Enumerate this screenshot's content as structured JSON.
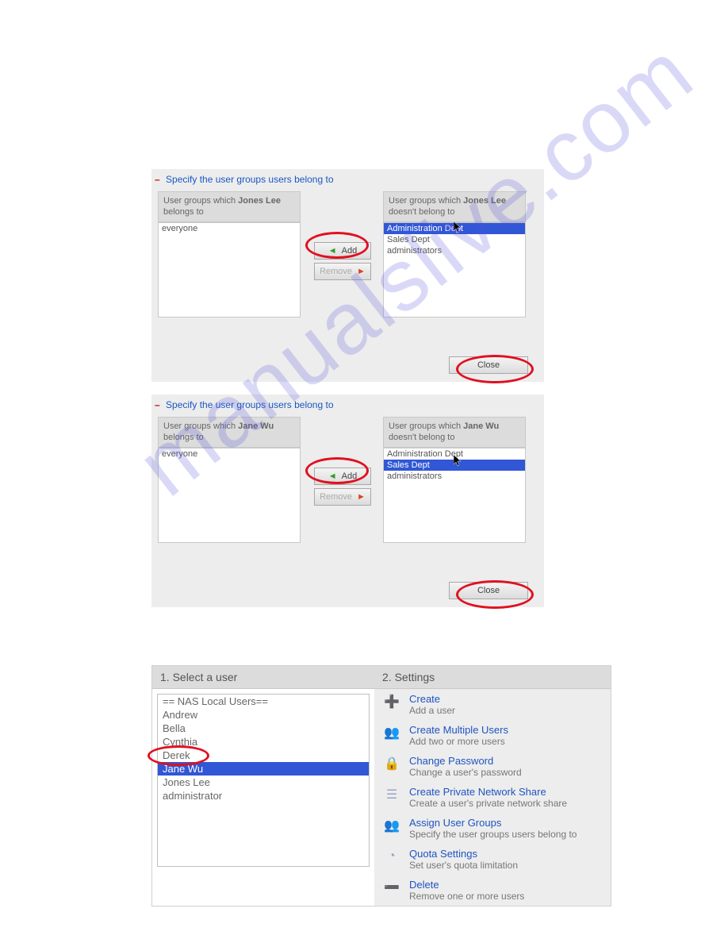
{
  "dialog1": {
    "section_title": "Specify the user groups users belong to",
    "user_name": "Jones Lee",
    "left_header_prefix": "User groups which ",
    "left_header_suffix": " belongs to",
    "right_header_prefix": "User groups which ",
    "right_header_suffix": " doesn't belong to",
    "left_items": [
      "everyone"
    ],
    "right_items": [
      "Administration Dept",
      "Sales Dept",
      "administrators"
    ],
    "right_selected_index": 0,
    "add_label": "Add",
    "remove_label": "Remove",
    "close_label": "Close"
  },
  "dialog2": {
    "section_title": "Specify the user groups users belong to",
    "user_name": "Jane Wu",
    "left_header_prefix": "User groups which ",
    "left_header_suffix": " belongs to",
    "right_header_prefix": "User groups which ",
    "right_header_suffix": " doesn't belong to",
    "left_items": [
      "everyone"
    ],
    "right_items": [
      "Administration Dept",
      "Sales Dept",
      "administrators"
    ],
    "right_selected_index": 1,
    "add_label": "Add",
    "remove_label": "Remove",
    "close_label": "Close"
  },
  "bottom": {
    "left_title": "1. Select a user",
    "right_title": "2. Settings",
    "items": [
      "== NAS Local Users==",
      "Andrew",
      "Bella",
      "Cynthia",
      "Derek",
      "Jane Wu",
      "Jones Lee",
      "administrator"
    ],
    "selected_index": 5,
    "actions": [
      {
        "title": "Create",
        "sub": "Add a user",
        "icon": "plus-user"
      },
      {
        "title": "Create Multiple Users",
        "sub": "Add two or more users",
        "icon": "multi-user"
      },
      {
        "title": "Change Password",
        "sub": "Change a user's password",
        "icon": "lock"
      },
      {
        "title": "Create Private Network Share",
        "sub": "Create a user's private network share",
        "icon": "share"
      },
      {
        "title": "Assign User Groups",
        "sub": "Specify the user groups users belong to",
        "icon": "group"
      },
      {
        "title": "Quota Settings",
        "sub": "Set user's quota limitation",
        "icon": "quota"
      },
      {
        "title": "Delete",
        "sub": "Remove one or more users",
        "icon": "minus-user"
      }
    ]
  },
  "watermark_text": "manualslive.com"
}
